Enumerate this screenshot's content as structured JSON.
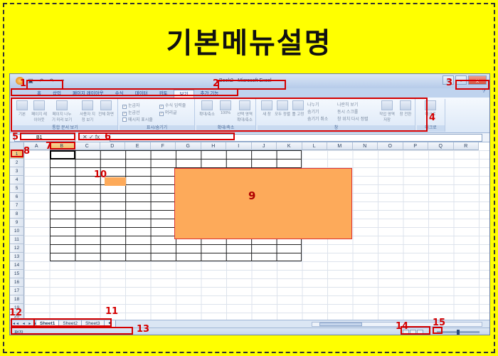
{
  "page": {
    "title": "기본메뉴설명"
  },
  "window": {
    "title": "Book2 - Microsoft Excel",
    "minimize": "–",
    "restore": "▫",
    "close": "x"
  },
  "tabs": [
    "홈",
    "삽입",
    "페이지 레이아웃",
    "수식",
    "데이터",
    "검토",
    "보기",
    "추가 기능"
  ],
  "tab_help": "?",
  "ribbon": {
    "groups": [
      {
        "label": "통합 문서 보기",
        "buttons": [
          "기본",
          "페이지 레이아웃",
          "페이지 나누기 미리 보기",
          "사용자 지정 보기",
          "전체 화면"
        ]
      },
      {
        "label": "표시/숨기기",
        "checks": [
          "눈금자",
          "눈금선",
          "메시지 표시줄",
          "수식 입력줄",
          "머리글"
        ]
      },
      {
        "label": "확대/축소",
        "buttons": [
          "확대/축소",
          "100%",
          "선택 영역 확대/축소"
        ]
      },
      {
        "label": "창",
        "buttons": [
          "새 창",
          "모두 정렬",
          "틀 고정"
        ],
        "items": [
          "나누기",
          "숨기기",
          "숨기기 취소",
          "나란히 보기",
          "동시 스크롤",
          "창 위치 다시 정렬"
        ],
        "extra": [
          "작업 영역 저장",
          "창 전환"
        ]
      },
      {
        "label": "매크로",
        "buttons": [
          "매크로"
        ]
      }
    ]
  },
  "formula_bar": {
    "name_box": "B1",
    "cancel": "✕",
    "enter": "✓",
    "fx": "fx"
  },
  "grid": {
    "columns": [
      "A",
      "B",
      "C",
      "D",
      "E",
      "F",
      "G",
      "H",
      "I",
      "J",
      "K",
      "L",
      "M",
      "N",
      "O",
      "P",
      "Q",
      "R"
    ],
    "rows": [
      "1",
      "2",
      "3",
      "4",
      "5",
      "6",
      "7",
      "8",
      "9",
      "10",
      "11",
      "12",
      "13",
      "14",
      "15",
      "16",
      "17",
      "18",
      "19",
      "20"
    ]
  },
  "sheets": [
    "Sheet1",
    "Sheet2",
    "Sheet3"
  ],
  "sheet_nav": "◂◂ ◂ ▸ ▸▸",
  "status": "편집",
  "markers": [
    "1",
    "2",
    "3",
    "4",
    "5",
    "6",
    "7",
    "8",
    "9",
    "10",
    "11",
    "12",
    "13",
    "14",
    "15"
  ],
  "colors": {
    "accent": "#d40000",
    "highlight": "#fdaa5a",
    "background": "#ffff00"
  }
}
